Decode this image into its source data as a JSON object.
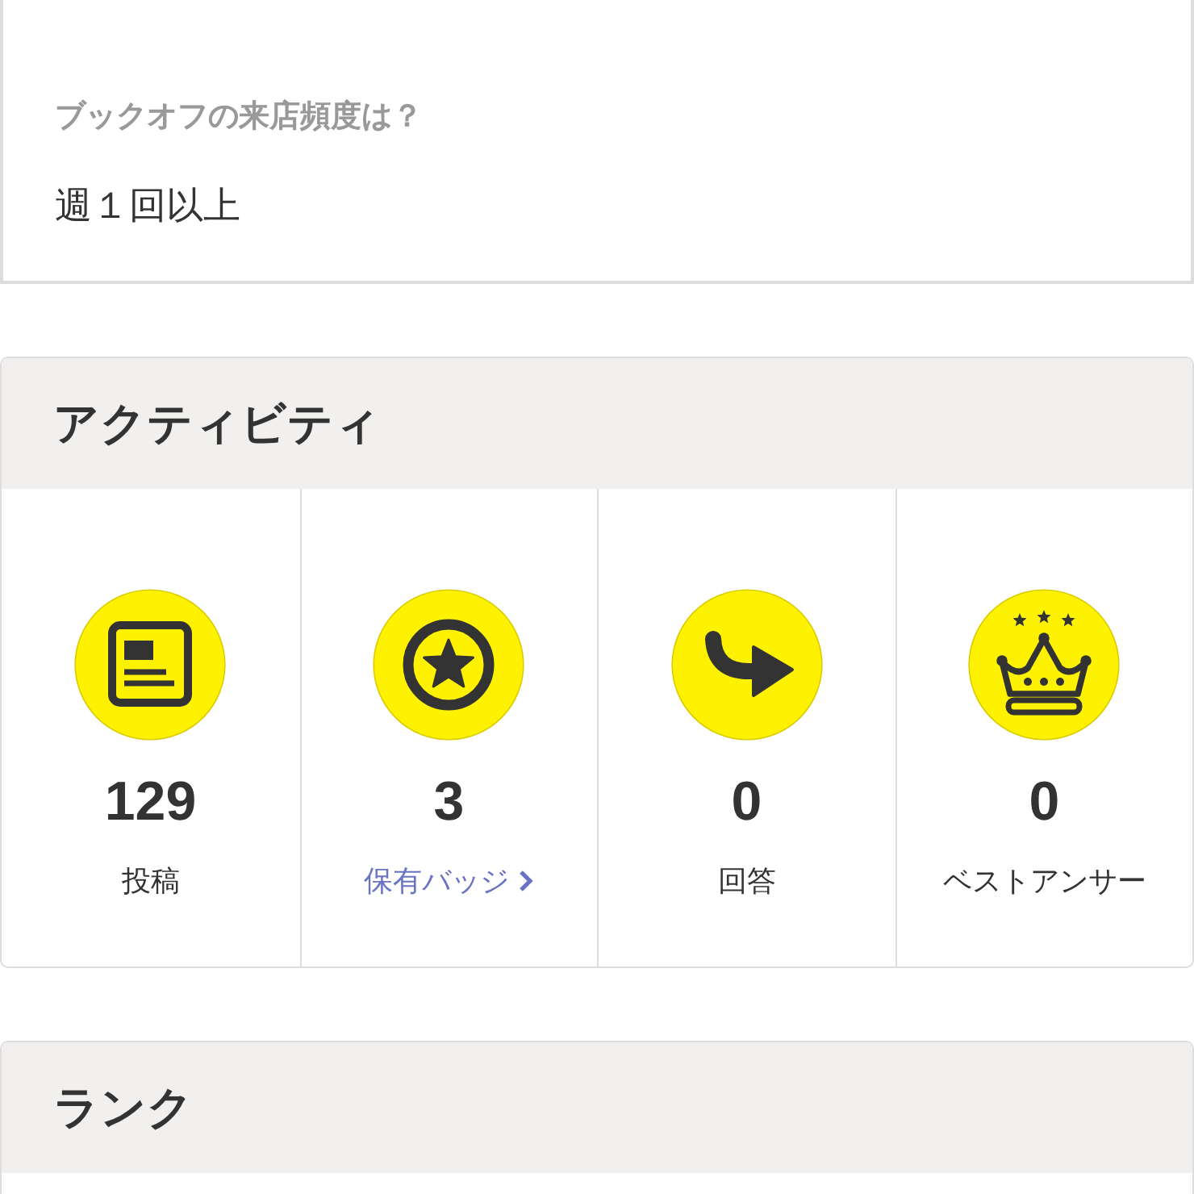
{
  "profile_answer": {
    "question": "ブックオフの来店頻度は？",
    "answer": "週１回以上"
  },
  "activity": {
    "title": "アクティビティ",
    "stats": [
      {
        "kind": "posts",
        "value": "129",
        "label": "投稿",
        "link": false
      },
      {
        "kind": "badges",
        "value": "3",
        "label": "保有バッジ",
        "link": true
      },
      {
        "kind": "answers",
        "value": "0",
        "label": "回答",
        "link": false
      },
      {
        "kind": "best_answers",
        "value": "0",
        "label": "ベストアンサー",
        "link": false
      }
    ]
  },
  "rank": {
    "title": "ランク"
  }
}
